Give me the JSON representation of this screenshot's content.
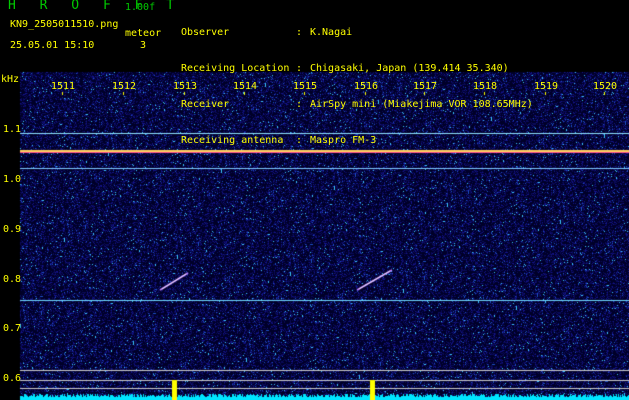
{
  "header": {
    "app_title": "H R O F F T",
    "version": "1.00f",
    "filename": "KN9_2505011510.png",
    "mode": "meteor",
    "datetime": "25.05.01 15:10",
    "count": "3",
    "info": [
      {
        "label": "Observer",
        "value": "K.Nagai"
      },
      {
        "label": "Receiving Location",
        "value": "Chigasaki, Japan (139.414 35.340)"
      },
      {
        "label": "Receiver",
        "value": "AirSpy mini (Miakejima VOR 108.65MHz)"
      },
      {
        "label": "Receiving antenna",
        "value": "Maspro FM-3"
      }
    ]
  },
  "chart_data": {
    "type": "heatmap",
    "y_unit": "kHz",
    "y_ticks": [
      "1.1",
      "1.0",
      "0.9",
      "0.8",
      "0.7",
      "0.6"
    ],
    "x_ticks": [
      "1511",
      "1512",
      "1513",
      "1514",
      "1515",
      "1516",
      "1517",
      "1518",
      "1519",
      "1520"
    ],
    "colors": {
      "background": "#000033",
      "label": "#ffff00",
      "spectrum": "#00e5ff",
      "peak": "#ffff00"
    }
  }
}
